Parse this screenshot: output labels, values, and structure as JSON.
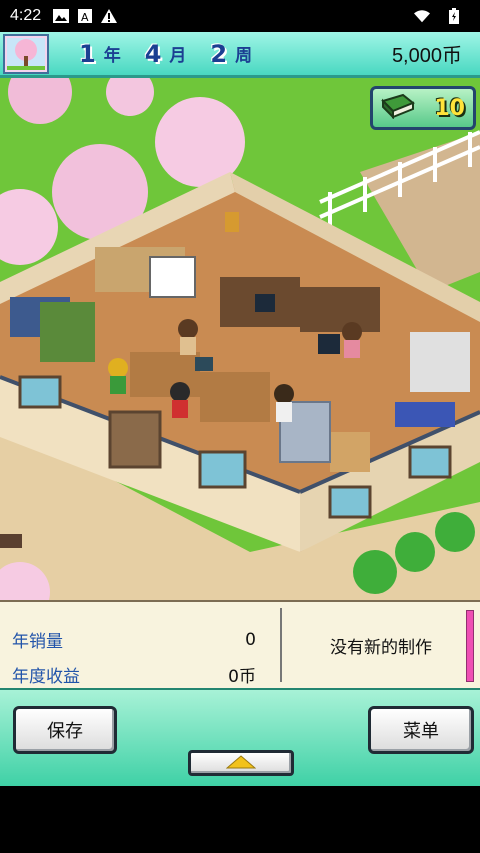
{
  "status_bar": {
    "time": "4:22",
    "icons": [
      "image-icon",
      "a-badge-icon",
      "warning-icon",
      "wifi-icon",
      "battery-icon"
    ]
  },
  "hud": {
    "season_icon": "cherry-tree-icon",
    "year_num": "1",
    "year_unit": "年",
    "month_num": "4",
    "month_unit": "月",
    "week_num": "2",
    "week_unit": "周",
    "money": "5,000币"
  },
  "research": {
    "icon": "book-icon",
    "value": "10"
  },
  "info_panel": {
    "annual_sales_label": "年销量",
    "annual_sales_value": "0",
    "annual_revenue_label": "年度收益",
    "annual_revenue_value": "0币",
    "message": "没有新的制作"
  },
  "controls": {
    "save_label": "保存",
    "menu_label": "菜单",
    "up_icon": "up-triangle-icon"
  },
  "colors": {
    "hud_top": "#9ff5e6",
    "hud_bottom": "#49d8c1",
    "label_blue": "#2254aa",
    "pink_bar": "#ef4fb4",
    "grass": "#6fc63a"
  }
}
